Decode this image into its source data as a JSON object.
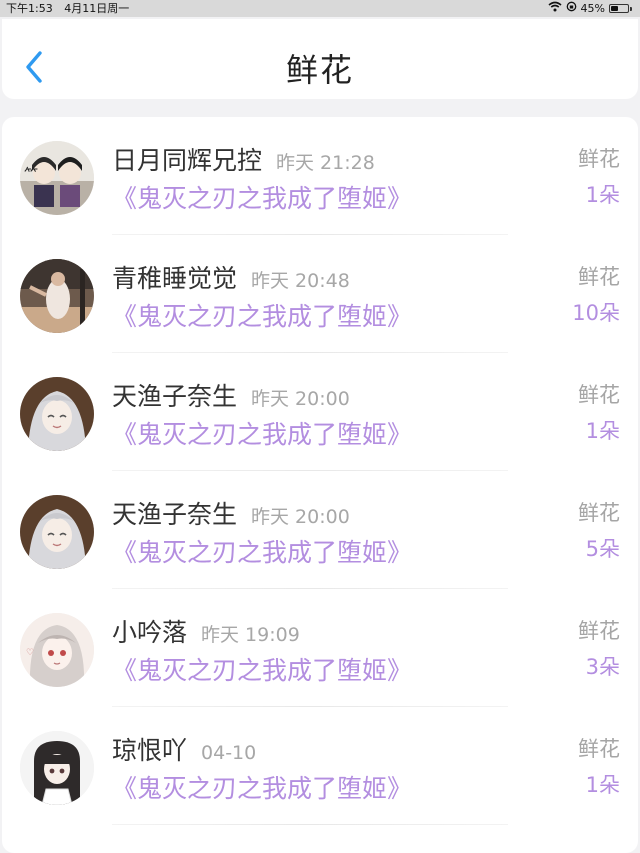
{
  "status": {
    "time": "下午1:53",
    "date": "4月11日周一",
    "battery": "45%",
    "battery_level": 0.45
  },
  "header": {
    "title": "鲜花",
    "back_icon": "chevron-left-icon",
    "accent_color": "#2f9af0"
  },
  "gift_items": [
    {
      "user": "日月同辉兄控",
      "time": "昨天 21:28",
      "book": "《鬼灭之刃之我成了堕姬》",
      "type": "鲜花",
      "count": "1朵"
    },
    {
      "user": "青稚睡觉觉",
      "time": "昨天 20:48",
      "book": "《鬼灭之刃之我成了堕姬》",
      "type": "鲜花",
      "count": "10朵"
    },
    {
      "user": "天渔子奈生",
      "time": "昨天 20:00",
      "book": "《鬼灭之刃之我成了堕姬》",
      "type": "鲜花",
      "count": "1朵"
    },
    {
      "user": "天渔子奈生",
      "time": "昨天 20:00",
      "book": "《鬼灭之刃之我成了堕姬》",
      "type": "鲜花",
      "count": "5朵"
    },
    {
      "user": "小吟落",
      "time": "昨天 19:09",
      "book": "《鬼灭之刃之我成了堕姬》",
      "type": "鲜花",
      "count": "3朵"
    },
    {
      "user": "琼恨吖",
      "time": "04-10",
      "book": "《鬼灭之刃之我成了堕姬》",
      "type": "鲜花",
      "count": "1朵"
    }
  ],
  "colors": {
    "book_title": "#b38ee0",
    "muted": "#a7a7a7"
  }
}
